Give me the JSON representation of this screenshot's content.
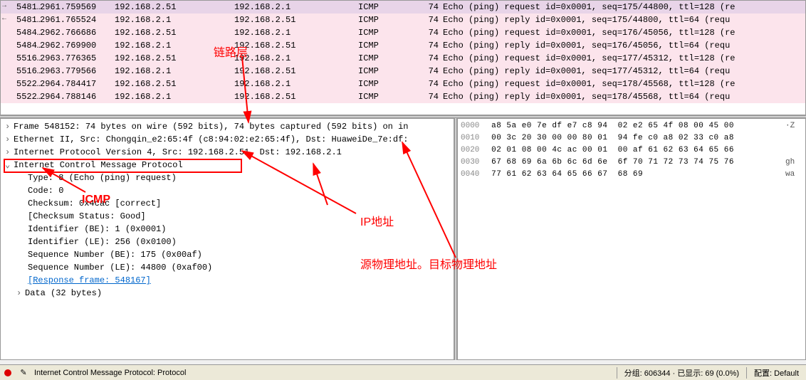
{
  "packet_list": [
    {
      "no": "5481…",
      "time": "2961.759569",
      "src": "192.168.2.51",
      "dst": "192.168.2.1",
      "proto": "ICMP",
      "len": "74",
      "info": "Echo (ping) request  id=0x0001, seq=175/44800, ttl=128 (re",
      "cls": "request",
      "marker": "→"
    },
    {
      "no": "5481…",
      "time": "2961.765524",
      "src": "192.168.2.1",
      "dst": "192.168.2.51",
      "proto": "ICMP",
      "len": "74",
      "info": "Echo (ping) reply    id=0x0001, seq=175/44800, ttl=64 (requ",
      "cls": "reply",
      "marker": "←"
    },
    {
      "no": "5484…",
      "time": "2962.766686",
      "src": "192.168.2.51",
      "dst": "192.168.2.1",
      "proto": "ICMP",
      "len": "74",
      "info": "Echo (ping) request  id=0x0001, seq=176/45056, ttl=128 (re",
      "cls": "request",
      "marker": ""
    },
    {
      "no": "5484…",
      "time": "2962.769900",
      "src": "192.168.2.1",
      "dst": "192.168.2.51",
      "proto": "ICMP",
      "len": "74",
      "info": "Echo (ping) reply    id=0x0001, seq=176/45056, ttl=64 (requ",
      "cls": "reply",
      "marker": ""
    },
    {
      "no": "5516…",
      "time": "2963.776365",
      "src": "192.168.2.51",
      "dst": "192.168.2.1",
      "proto": "ICMP",
      "len": "74",
      "info": "Echo (ping) request  id=0x0001, seq=177/45312, ttl=128 (re",
      "cls": "request",
      "marker": ""
    },
    {
      "no": "5516…",
      "time": "2963.779566",
      "src": "192.168.2.1",
      "dst": "192.168.2.51",
      "proto": "ICMP",
      "len": "74",
      "info": "Echo (ping) reply    id=0x0001, seq=177/45312, ttl=64 (requ",
      "cls": "reply",
      "marker": ""
    },
    {
      "no": "5522…",
      "time": "2964.784417",
      "src": "192.168.2.51",
      "dst": "192.168.2.1",
      "proto": "ICMP",
      "len": "74",
      "info": "Echo (ping) request  id=0x0001, seq=178/45568, ttl=128 (re",
      "cls": "request",
      "marker": ""
    },
    {
      "no": "5522…",
      "time": "2964.788146",
      "src": "192.168.2.1",
      "dst": "192.168.2.51",
      "proto": "ICMP",
      "len": "74",
      "info": "Echo (ping) reply    id=0x0001, seq=178/45568, ttl=64 (requ",
      "cls": "reply",
      "marker": ""
    }
  ],
  "tree": {
    "frame": "Frame 548152: 74 bytes on wire (592 bits), 74 bytes captured (592 bits) on in",
    "eth": "Ethernet II, Src: Chongqin_e2:65:4f (c8:94:02:e2:65:4f), Dst: HuaweiDe_7e:df:",
    "ip": "Internet Protocol Version 4, Src: 192.168.2.51, Dst: 192.168.2.1",
    "icmp": "Internet Control Message Protocol",
    "type": "Type: 8 (Echo (ping) request)",
    "code": "Code: 0",
    "checksum": "Checksum: 0x4cac [correct]",
    "chkstatus": "[Checksum Status: Good]",
    "id_be": "Identifier (BE): 1 (0x0001)",
    "id_le": "Identifier (LE): 256 (0x0100)",
    "seq_be": "Sequence Number (BE): 175 (0x00af)",
    "seq_le": "Sequence Number (LE): 44800 (0xaf00)",
    "response": "[Response frame: 548167]",
    "data": "Data (32 bytes)"
  },
  "hex": [
    {
      "off": "0000",
      "bytes": "a8 5a e0 7e df e7 c8 94  02 e2 65 4f 08 00 45 00",
      "asc": "·Z"
    },
    {
      "off": "0010",
      "bytes": "00 3c 20 30 00 00 80 01  94 fe c0 a8 02 33 c0 a8",
      "asc": ""
    },
    {
      "off": "0020",
      "bytes": "02 01 08 00 4c ac 00 01  00 af 61 62 63 64 65 66",
      "asc": ""
    },
    {
      "off": "0030",
      "bytes": "67 68 69 6a 6b 6c 6d 6e  6f 70 71 72 73 74 75 76",
      "asc": "gh"
    },
    {
      "off": "0040",
      "bytes": "77 61 62 63 64 65 66 67  68 69",
      "asc": "wa"
    }
  ],
  "status": {
    "text": "Internet Control Message Protocol: Protocol",
    "packets": "分组: 606344 · 已显示: 69 (0.0%)",
    "profile": "配置: Default"
  },
  "annotations": {
    "link_layer": "链路层",
    "icmp": "ICMP",
    "ip_addr": "IP地址",
    "phys_addr": "源物理地址。目标物理地址"
  }
}
